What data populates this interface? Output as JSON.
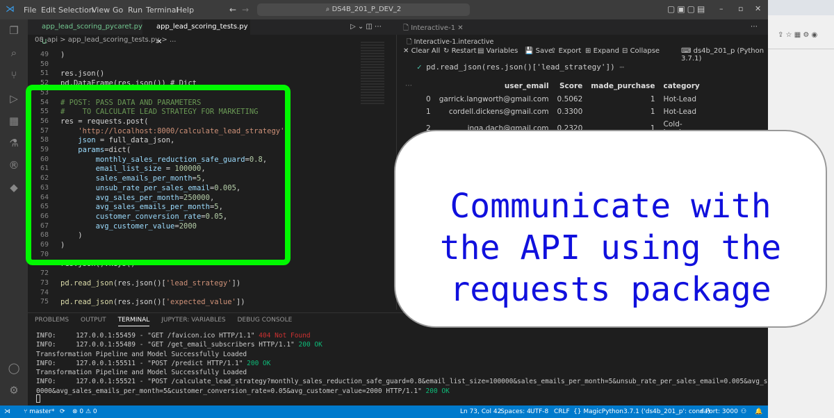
{
  "titlebar": {
    "menus": [
      "File",
      "Edit",
      "Selection",
      "View",
      "Go",
      "Run",
      "Terminal",
      "Help"
    ],
    "search": "DS4B_201_P_DEV_2"
  },
  "tabs": {
    "tab1": "app_lead_scoring_pycaret.py",
    "tab1_badge": "U",
    "tab2": "app_lead_scoring_tests.py"
  },
  "breadcrumb": "08_api > app_lead_scoring_tests.py > ...",
  "code_lines": [
    {
      "n": "49",
      "t": ")"
    },
    {
      "n": "50",
      "t": ""
    },
    {
      "n": "51",
      "t": "res.json()"
    },
    {
      "n": "52",
      "t": "pd.DataFrame(res.json()) # Dict"
    },
    {
      "n": "53",
      "t": ""
    },
    {
      "n": "54",
      "t": "# POST: PASS DATA AND PARAMETERS"
    },
    {
      "n": "55",
      "t": "#    TO CALCULATE LEAD STRATEGY FOR MARKETING"
    },
    {
      "n": "56",
      "t": "res = requests.post("
    },
    {
      "n": "57",
      "t": "    'http://localhost:8000/calculate_lead_strategy',"
    },
    {
      "n": "58",
      "t": "    json = full_data_json,"
    },
    {
      "n": "59",
      "t": "    params=dict("
    },
    {
      "n": "60",
      "t": "        monthly_sales_reduction_safe_guard=0.8,"
    },
    {
      "n": "61",
      "t": "        email_list_size = 100000,"
    },
    {
      "n": "62",
      "t": "        sales_emails_per_month=5,"
    },
    {
      "n": "63",
      "t": "        unsub_rate_per_sales_email=0.005,"
    },
    {
      "n": "64",
      "t": "        avg_sales_per_month=250000,"
    },
    {
      "n": "65",
      "t": "        avg_sales_emails_per_month=5,"
    },
    {
      "n": "66",
      "t": "        customer_conversion_rate=0.05,"
    },
    {
      "n": "67",
      "t": "        avg_customer_value=2000"
    },
    {
      "n": "68",
      "t": "    )"
    },
    {
      "n": "69",
      "t": ")"
    },
    {
      "n": "70",
      "t": ""
    },
    {
      "n": "71",
      "t": "res.json().keys()"
    },
    {
      "n": "72",
      "t": ""
    },
    {
      "n": "73",
      "t": "pd.read_json(res.json()['lead_strategy'])"
    },
    {
      "n": "74",
      "t": ""
    },
    {
      "n": "75",
      "t": "pd.read_json(res.json()['expected_value'])"
    }
  ],
  "interactive": {
    "tab": "Interactive-1",
    "file": "Interactive-1.interactive",
    "toolbar": [
      "Clear All",
      "Restart",
      "Variables",
      "Save",
      "Export",
      "Expand",
      "Collapse"
    ],
    "kernel": "ds4b_201_p (Python 3.7.1)",
    "cell_code": "pd.read_json(res.json()['lead_strategy'])",
    "columns": [
      "",
      "user_email",
      "Score",
      "made_purchase",
      "category"
    ],
    "rows": [
      [
        "0",
        "garrick.langworth@gmail.com",
        "0.5062",
        "1",
        "Hot-Lead"
      ],
      [
        "1",
        "cordell.dickens@gmail.com",
        "0.3300",
        "1",
        "Hot-Lead"
      ],
      [
        "2",
        "inga.dach@gmail.com",
        "0.2320",
        "1",
        "Cold-Lead"
      ]
    ]
  },
  "panel": {
    "tabs": [
      "PROBLEMS",
      "OUTPUT",
      "TERMINAL",
      "JUPYTER: VARIABLES",
      "DEBUG CONSOLE"
    ],
    "terminal": [
      {
        "pre": "INFO:     127.0.0.1:55459 - \"GET /favicon.ico HTTP/1.1\" ",
        "status": "404 Not Found",
        "cls": "nf"
      },
      {
        "pre": "INFO:     127.0.0.1:55489 - \"GET /get_email_subscribers HTTP/1.1\" ",
        "status": "200 OK",
        "cls": "ok"
      },
      {
        "pre": "Transformation Pipeline and Model Successfully Loaded",
        "status": "",
        "cls": ""
      },
      {
        "pre": "INFO:     127.0.0.1:55511 - \"POST /predict HTTP/1.1\" ",
        "status": "200 OK",
        "cls": "ok"
      },
      {
        "pre": "Transformation Pipeline and Model Successfully Loaded",
        "status": "",
        "cls": ""
      },
      {
        "pre": "INFO:     127.0.0.1:55521 - \"POST /calculate_lead_strategy?monthly_sales_reduction_safe_guard=0.8&email_list_size=100000&sales_emails_per_month=5&unsub_rate_per_sales_email=0.005&avg_sales_per_month=25",
        "status": "",
        "cls": ""
      },
      {
        "pre": "0000&avg_sales_emails_per_month=5&customer_conversion_rate=0.05&avg_customer_value=2000 HTTP/1.1\" ",
        "status": "200 OK",
        "cls": "ok"
      }
    ]
  },
  "statusbar": {
    "branch": "master*",
    "problems": "⊗ 0 ⚠ 0",
    "position": "Ln 73, Col 42",
    "spaces": "Spaces: 4",
    "encoding": "UTF-8",
    "eol": "CRLF",
    "language": "MagicPython",
    "interpreter": "3.7.1 ('ds4b_201_p': conda)",
    "port": "Port: 3000"
  },
  "callout": {
    "line1": "Communicate with",
    "line2": "the API using the",
    "line3": "requests package"
  },
  "colors": {
    "highlight": "#00f800",
    "callout_text": "#1010dd",
    "statusbar": "#007acc"
  }
}
